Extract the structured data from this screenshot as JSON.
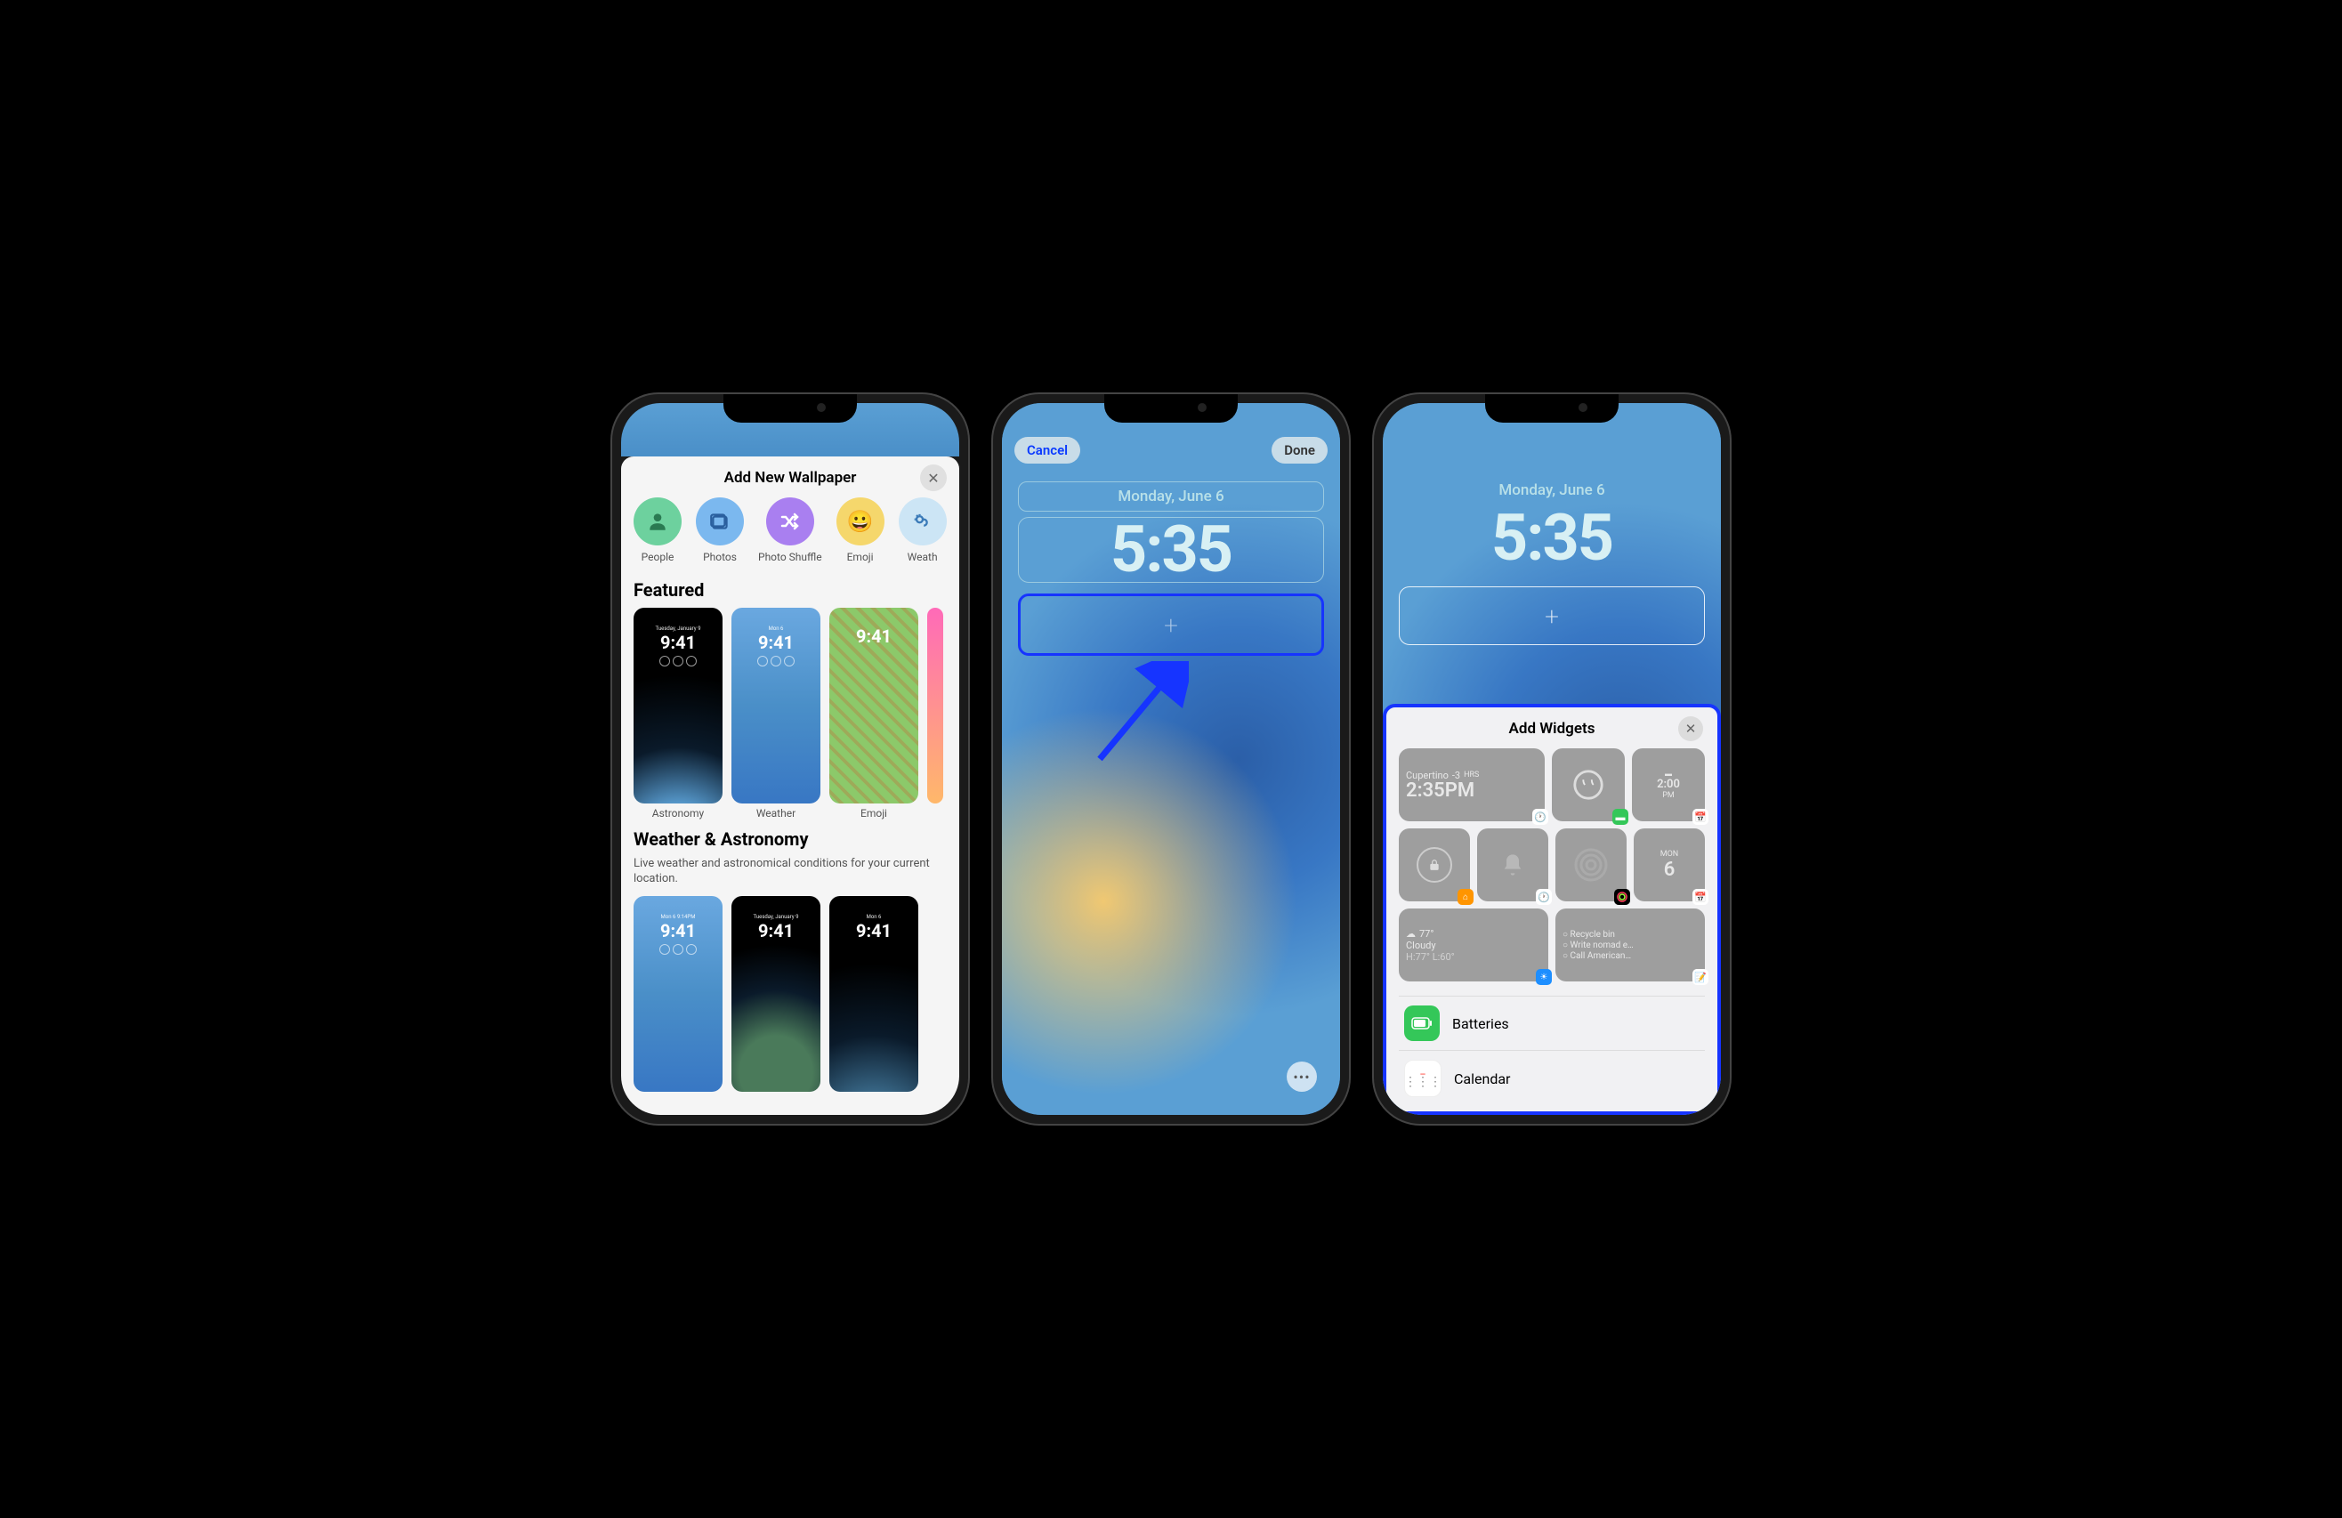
{
  "phone1": {
    "title": "Add New Wallpaper",
    "categories": [
      {
        "label": "People"
      },
      {
        "label": "Photos"
      },
      {
        "label": "Photo Shuffle"
      },
      {
        "label": "Emoji"
      },
      {
        "label": "Weath"
      }
    ],
    "featured": {
      "title": "Featured",
      "items": [
        {
          "label": "Astronomy",
          "date": "Tuesday, January 9",
          "time": "9:41"
        },
        {
          "label": "Weather",
          "date": "Mon 6",
          "time": "9:41"
        },
        {
          "label": "Emoji",
          "date": "",
          "time": "9:41"
        }
      ]
    },
    "section2": {
      "title": "Weather & Astronomy",
      "subtitle": "Live weather and astronomical conditions for your current location.",
      "items": [
        {
          "date": "Mon 6  9:14PM",
          "time": "9:41"
        },
        {
          "date": "Tuesday, January 9",
          "time": "9:41"
        },
        {
          "date": "Mon 6",
          "time": "9:41"
        }
      ]
    }
  },
  "phone2": {
    "cancel": "Cancel",
    "done": "Done",
    "date": "Monday, June 6",
    "time": "5:35",
    "plus": "+"
  },
  "phone3": {
    "date": "Monday, June 6",
    "time": "5:35",
    "plus": "+",
    "sheet_title": "Add Widgets",
    "clock_widget": {
      "city": "Cupertino",
      "offset": "-3",
      "offset_label": "HRS",
      "time": "2:35PM"
    },
    "cal_small": {
      "time": "2:00",
      "ampm": "PM"
    },
    "cal_day": {
      "dow": "MON",
      "day": "6"
    },
    "weather": {
      "temp": "77°",
      "cond": "Cloudy",
      "hilo": "H:77° L:60°"
    },
    "reminders": {
      "items": [
        "Recycle bin",
        "Write nomad e…",
        "Call American…"
      ]
    },
    "apps": [
      {
        "label": "Batteries"
      },
      {
        "label": "Calendar"
      }
    ]
  }
}
